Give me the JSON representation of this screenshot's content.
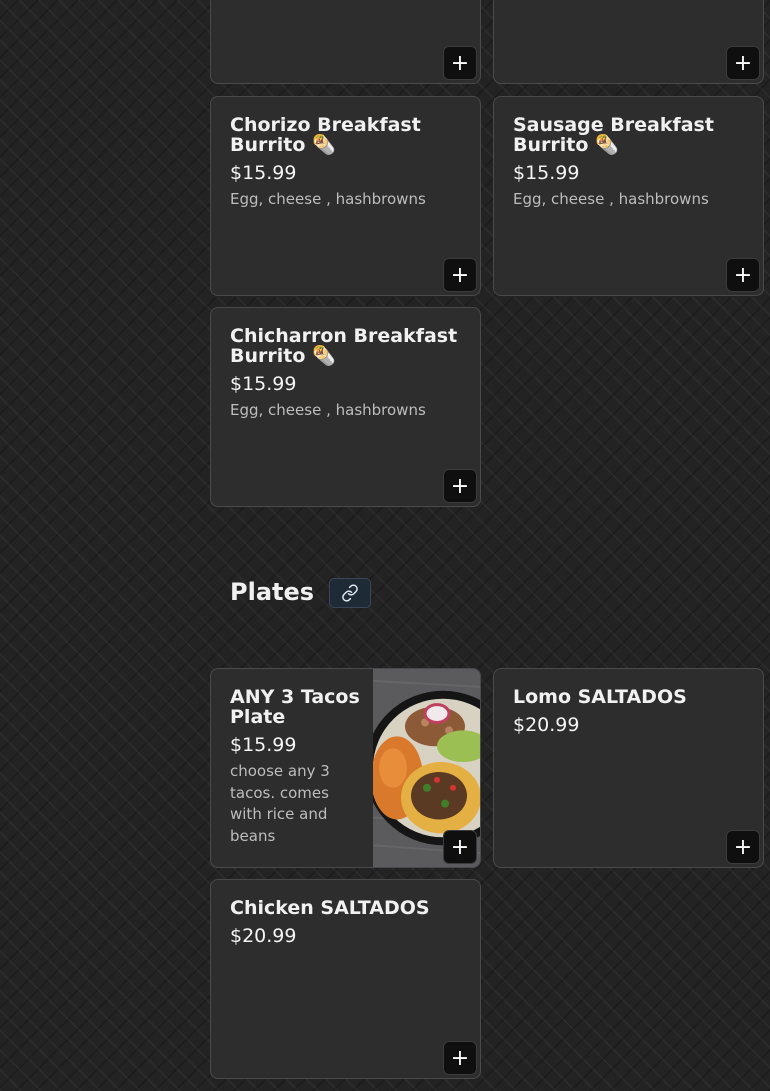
{
  "breakfast_items": [
    {
      "name": "",
      "price": "",
      "desc": "",
      "add_label": "+"
    },
    {
      "name": "",
      "price": "",
      "desc": "",
      "add_label": "+"
    },
    {
      "name": "Chorizo Breakfast Burrito 🌯",
      "price": "$15.99",
      "desc": "Egg, cheese , hashbrowns",
      "add_label": "+"
    },
    {
      "name": "Sausage Breakfast Burrito 🌯",
      "price": "$15.99",
      "desc": "Egg, cheese , hashbrowns",
      "add_label": "+"
    },
    {
      "name": "Chicharron Breakfast Burrito 🌯",
      "price": "$15.99",
      "desc": "Egg, cheese , hashbrowns",
      "add_label": "+"
    }
  ],
  "plates_section": {
    "title": "Plates",
    "link_icon": "link-icon",
    "items": [
      {
        "name": "ANY 3 Tacos Plate",
        "price": "$15.99",
        "desc": "choose any 3 tacos. comes with rice and beans",
        "image": "tacos-plate-photo",
        "add_label": "+"
      },
      {
        "name": "Lomo SALTADOS",
        "price": "$20.99",
        "desc": "",
        "add_label": "+"
      },
      {
        "name": "Chicken SALTADOS",
        "price": "$20.99",
        "desc": "",
        "add_label": "+"
      }
    ]
  },
  "colors": {
    "background": "#232324",
    "card": "#2d2d2e",
    "card_border": "#4a4a4c",
    "button": "#0f0f10",
    "link_button": "#1f2a37"
  }
}
